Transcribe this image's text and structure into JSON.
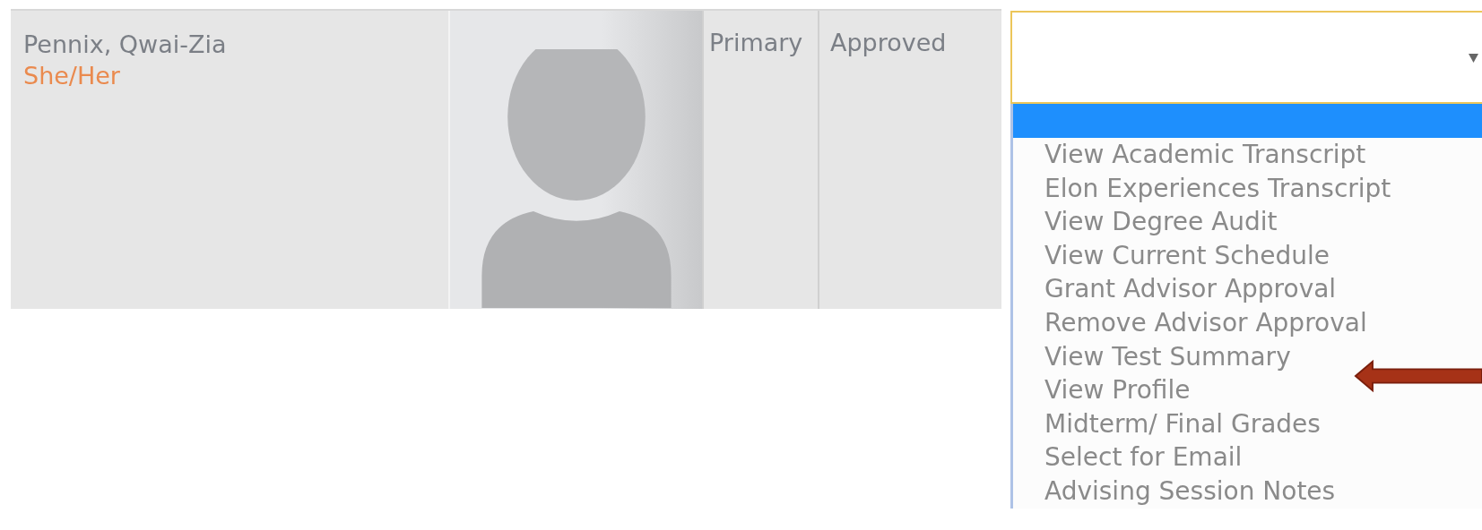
{
  "row": {
    "name": "Pennix, Qwai-Zia",
    "pronouns": "She/Her",
    "role": "Primary",
    "status": "Approved"
  },
  "dropdown": {
    "blank_option_highlighted": true,
    "options": [
      {
        "label": "View Academic Transcript",
        "selected": false
      },
      {
        "label": "Elon Experiences Transcript",
        "selected": false
      },
      {
        "label": "View Degree Audit",
        "selected": false
      },
      {
        "label": "View Current Schedule",
        "selected": false
      },
      {
        "label": "Grant Advisor Approval",
        "selected": false
      },
      {
        "label": "Remove Advisor Approval",
        "selected": false
      },
      {
        "label": "View Test Summary",
        "selected": false
      },
      {
        "label": "View Profile",
        "selected": false
      },
      {
        "label": "Midterm/ Final Grades",
        "selected": false
      },
      {
        "label": "Select for Email",
        "selected": false
      },
      {
        "label": "Advising Session Notes",
        "selected": false
      }
    ]
  }
}
